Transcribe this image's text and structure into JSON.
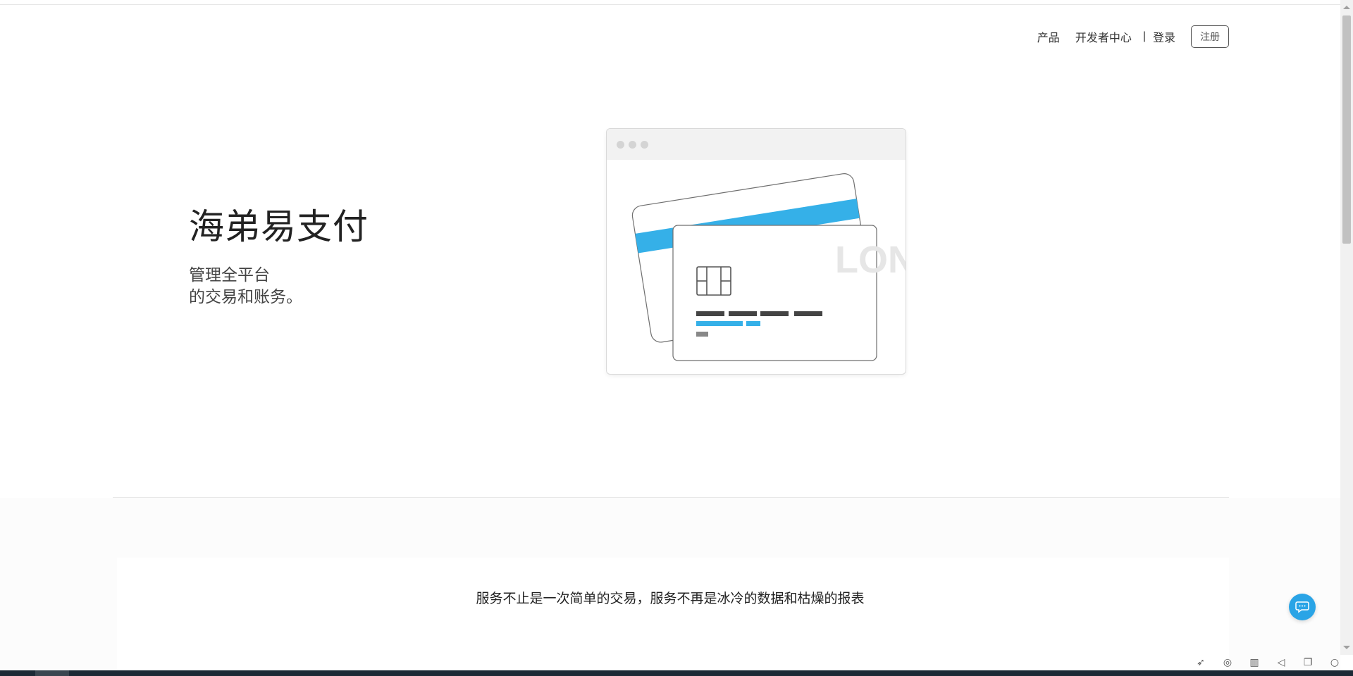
{
  "nav": {
    "products": "产品",
    "developer": "开发者中心",
    "separator": "|",
    "login": "登录",
    "signup": "注册"
  },
  "hero": {
    "title": "海弟易支付",
    "subtitle_line1": "管理全平台",
    "subtitle_line2": "的交易和账务。"
  },
  "illustration": {
    "card_text": "LON"
  },
  "section": {
    "tagline": "服务不止是一次简单的交易，服务不再是冰冷的数据和枯燥的报表"
  },
  "colors": {
    "accent": "#35b0e8",
    "chat_button": "#2aa4e6"
  },
  "icons": {
    "chat": "chat-bubble-icon",
    "toolbar": [
      "rocket-icon",
      "edge-icon",
      "trash-icon",
      "speaker-icon",
      "window-icon",
      "search-icon"
    ]
  }
}
